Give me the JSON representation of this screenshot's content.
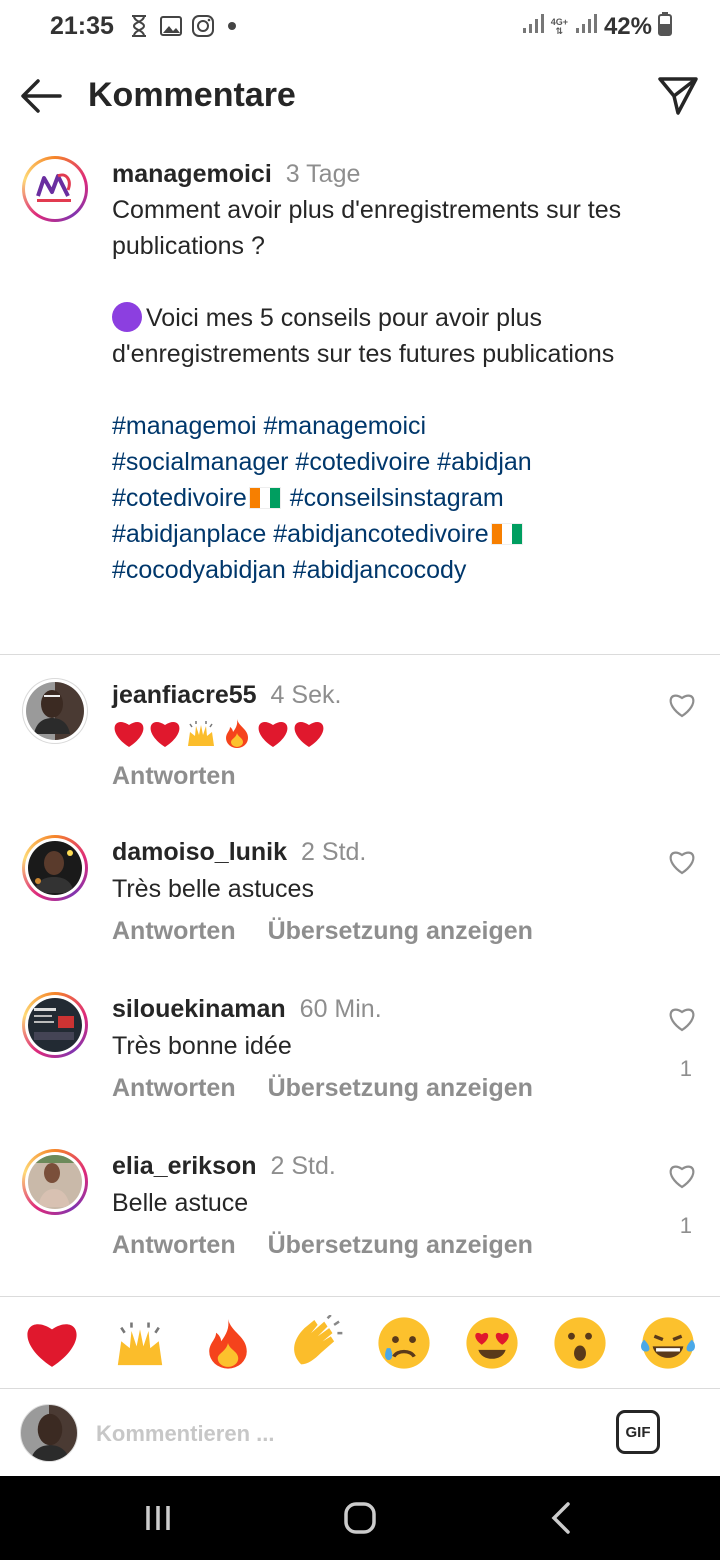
{
  "status_bar": {
    "time": "21:35",
    "battery": "42%",
    "network": "4G+",
    "icons_left": [
      "hourglass-icon",
      "gallery-icon",
      "instagram-icon"
    ],
    "icons_right": [
      "signal-icon",
      "battery-icon"
    ]
  },
  "header": {
    "title": "Kommentare",
    "back_icon": "arrow-left-icon",
    "share_icon": "send-icon"
  },
  "caption": {
    "username": "managemoici",
    "time": "3 Tage",
    "text_1": "Comment avoir plus d'enregistrements sur tes publications ?",
    "text_2": "Voici mes 5 conseils pour avoir plus d'enregistrements sur tes futures publications",
    "hashtags_line1": "#managemoi #managemoici",
    "hashtags_line2": "#socialmanager #cotedivoire #abidjan",
    "hashtags_line3a": "#cotedivoire",
    "hashtags_line3b": " #conseilsinstagram",
    "hashtags_line4a": "#abidjanplace #abidjancotedivoire",
    "hashtags_line5": "#cocodyabidjan #abidjancocody"
  },
  "comments": [
    {
      "username": "jeanfiacre55",
      "time": "4 Sek.",
      "text": "",
      "reply": "Antworten",
      "translate": "",
      "likes": ""
    },
    {
      "username": "damoiso_lunik",
      "time": "2 Std.",
      "text": "Très belle astuces",
      "reply": "Antworten",
      "translate": "Übersetzung anzeigen",
      "likes": ""
    },
    {
      "username": "silouekinaman",
      "time": "60 Min.",
      "text": "Très bonne idée",
      "reply": "Antworten",
      "translate": "Übersetzung anzeigen",
      "likes": "1"
    },
    {
      "username": "elia_erikson",
      "time": "2 Std.",
      "text": "Belle astuce",
      "reply": "Antworten",
      "translate": "Übersetzung anzeigen",
      "likes": "1"
    }
  ],
  "reactions": [
    "red-heart",
    "raising-hands",
    "fire",
    "clapping-hands",
    "crying-face",
    "heart-eyes-face",
    "astonished-face",
    "tears-of-joy-face"
  ],
  "comment_input": {
    "placeholder": "Kommentieren ...",
    "gif_label": "GIF"
  },
  "colors": {
    "hashtag": "#00376b",
    "secondary_text": "#8e8e8e",
    "story_ring": "#dd2a7b"
  }
}
